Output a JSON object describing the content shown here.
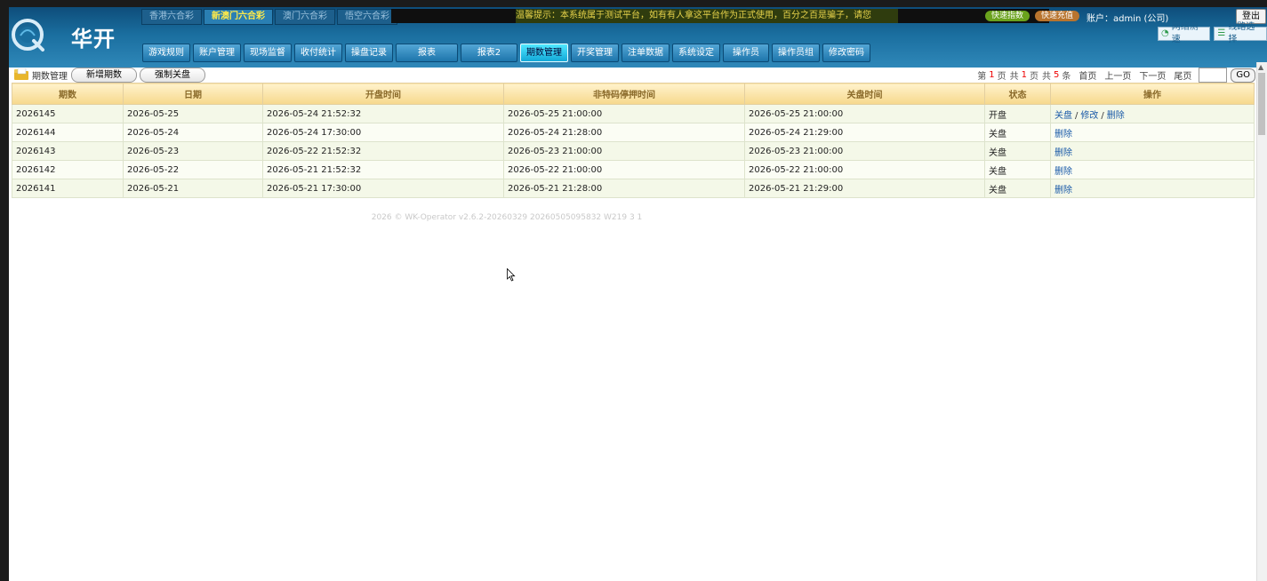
{
  "brand": {
    "name": "华开"
  },
  "lottery_tabs": [
    {
      "label": "香港六合彩",
      "active": false
    },
    {
      "label": "新澳门六合彩",
      "active": true
    },
    {
      "label": "澳门六合彩",
      "active": false
    },
    {
      "label": "悟空六合彩",
      "active": false
    }
  ],
  "notice": {
    "text": "温馨提示：本系统属于测试平台，如有有人拿这平台作为正式使用，百分之百是骗子，请您"
  },
  "header_buttons": {
    "left": "快速指数",
    "right": "快速充值"
  },
  "account": {
    "label": "账户：admin (公司)"
  },
  "logout_label": "登出",
  "tools": {
    "speed_test": "网络测速",
    "line_select": "线路选择"
  },
  "nav": [
    {
      "label": "游戏规则",
      "active": false
    },
    {
      "label": "账户管理",
      "active": false
    },
    {
      "label": "现场监督",
      "active": false
    },
    {
      "label": "收付统计",
      "active": false
    },
    {
      "label": "操盘记录",
      "active": false
    },
    {
      "label": "报表",
      "active": false
    },
    {
      "label": "报表2",
      "active": false
    },
    {
      "label": "期数管理",
      "active": true
    },
    {
      "label": "开奖管理",
      "active": false
    },
    {
      "label": "注单数据",
      "active": false
    },
    {
      "label": "系统设定",
      "active": false
    },
    {
      "label": "操作员",
      "active": false
    },
    {
      "label": "操作员组",
      "active": false
    },
    {
      "label": "修改密码",
      "active": false
    }
  ],
  "subbar": {
    "page_label": "期数管理",
    "add_button": "新增期数",
    "force_close_button": "强制关盘"
  },
  "pager": {
    "prefix": "第",
    "current_page": "1",
    "page_unit": "页",
    "total_prefix": "共",
    "total_pages": "1",
    "total_rows": "5",
    "rows_unit": "条",
    "first": "首页",
    "prev": "上一页",
    "next": "下一页",
    "last": "尾页",
    "go": "GO"
  },
  "table": {
    "columns": [
      "期数",
      "日期",
      "开盘时间",
      "非特码停押时间",
      "关盘时间",
      "状态",
      "操作"
    ],
    "rows": [
      {
        "issue": "2026145",
        "date": "2026-05-25",
        "open": "2026-05-24 21:52:32",
        "stop": "2026-05-25 21:00:00",
        "close": "2026-05-25 21:00:00",
        "status": "开盘",
        "ops": [
          "关盘",
          "修改",
          "删除"
        ]
      },
      {
        "issue": "2026144",
        "date": "2026-05-24",
        "open": "2026-05-24 17:30:00",
        "stop": "2026-05-24 21:28:00",
        "close": "2026-05-24 21:29:00",
        "status": "关盘",
        "ops": [
          "删除"
        ]
      },
      {
        "issue": "2026143",
        "date": "2026-05-23",
        "open": "2026-05-22 21:52:32",
        "stop": "2026-05-23 21:00:00",
        "close": "2026-05-23 21:00:00",
        "status": "关盘",
        "ops": [
          "删除"
        ]
      },
      {
        "issue": "2026142",
        "date": "2026-05-22",
        "open": "2026-05-21 21:52:32",
        "stop": "2026-05-22 21:00:00",
        "close": "2026-05-22 21:00:00",
        "status": "关盘",
        "ops": [
          "删除"
        ]
      },
      {
        "issue": "2026141",
        "date": "2026-05-21",
        "open": "2026-05-21 17:30:00",
        "stop": "2026-05-21 21:28:00",
        "close": "2026-05-21 21:29:00",
        "status": "关盘",
        "ops": [
          "删除"
        ]
      }
    ]
  },
  "footer": {
    "text": "2026 © WK-Operator v2.6.2-20260329 20260505095832 W219 3 1"
  },
  "colors": {
    "header_dark": "#0e4d7a",
    "header_light": "#2f88b9",
    "nav_active": "#4fe8ff",
    "table_head": "#f6d88c",
    "row_bg": "#f4f8e8",
    "link": "#1a5aa8",
    "highlight": "#ffea4a"
  }
}
